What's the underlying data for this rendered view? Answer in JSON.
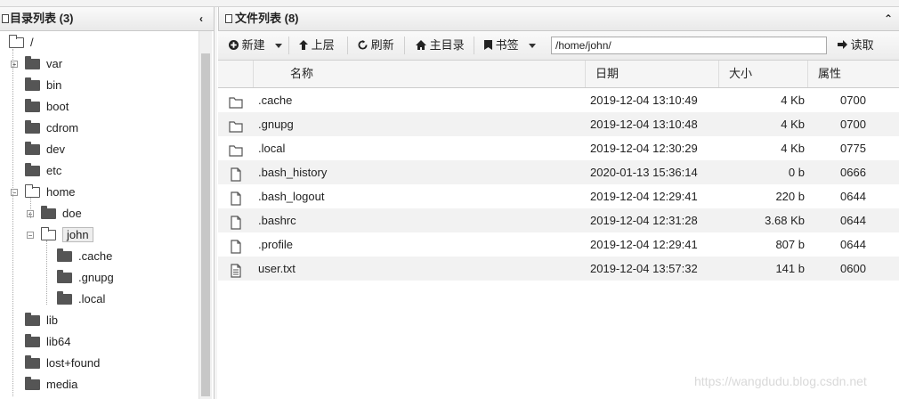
{
  "dir_panel": {
    "title": "目录列表 (3)",
    "collapse_glyph": "‹"
  },
  "tree": [
    {
      "label": "/",
      "depth": 0,
      "open": true
    },
    {
      "label": "var",
      "depth": 1,
      "expander": "+"
    },
    {
      "label": "bin",
      "depth": 1
    },
    {
      "label": "boot",
      "depth": 1
    },
    {
      "label": "cdrom",
      "depth": 1
    },
    {
      "label": "dev",
      "depth": 1
    },
    {
      "label": "etc",
      "depth": 1
    },
    {
      "label": "home",
      "depth": 1,
      "open": true,
      "expander": "−"
    },
    {
      "label": "doe",
      "depth": 2,
      "expander": "+"
    },
    {
      "label": "john",
      "depth": 2,
      "open": true,
      "selected": true,
      "expander": "−"
    },
    {
      "label": ".cache",
      "depth": 3
    },
    {
      "label": ".gnupg",
      "depth": 3
    },
    {
      "label": ".local",
      "depth": 3
    },
    {
      "label": "lib",
      "depth": 1
    },
    {
      "label": "lib64",
      "depth": 1
    },
    {
      "label": "lost+found",
      "depth": 1
    },
    {
      "label": "media",
      "depth": 1
    }
  ],
  "file_panel": {
    "title": "文件列表 (8)",
    "collapse_glyph": "⌃"
  },
  "toolbar": {
    "new_label": "新建",
    "up_label": "上层",
    "refresh_label": "刷新",
    "home_label": "主目录",
    "bookmark_label": "书签",
    "path_value": "/home/john/",
    "read_label": "读取"
  },
  "columns": {
    "name": "名称",
    "date": "日期",
    "size": "大小",
    "perm": "属性"
  },
  "files": [
    {
      "icon": "folder-icon",
      "name": ".cache",
      "date": "2019-12-04 13:10:49",
      "size": "4 Kb",
      "perm": "0700"
    },
    {
      "icon": "folder-icon",
      "name": ".gnupg",
      "date": "2019-12-04 13:10:48",
      "size": "4 Kb",
      "perm": "0700"
    },
    {
      "icon": "folder-icon",
      "name": ".local",
      "date": "2019-12-04 12:30:29",
      "size": "4 Kb",
      "perm": "0775"
    },
    {
      "icon": "file-icon",
      "name": ".bash_history",
      "date": "2020-01-13 15:36:14",
      "size": "0 b",
      "perm": "0666"
    },
    {
      "icon": "file-icon",
      "name": ".bash_logout",
      "date": "2019-12-04 12:29:41",
      "size": "220 b",
      "perm": "0644"
    },
    {
      "icon": "file-icon",
      "name": ".bashrc",
      "date": "2019-12-04 12:31:28",
      "size": "3.68 Kb",
      "perm": "0644"
    },
    {
      "icon": "file-icon",
      "name": ".profile",
      "date": "2019-12-04 12:29:41",
      "size": "807 b",
      "perm": "0644"
    },
    {
      "icon": "text-file-icon",
      "name": "user.txt",
      "date": "2019-12-04 13:57:32",
      "size": "141 b",
      "perm": "0600"
    }
  ],
  "watermark": "https://wangdudu.blog.csdn.net"
}
